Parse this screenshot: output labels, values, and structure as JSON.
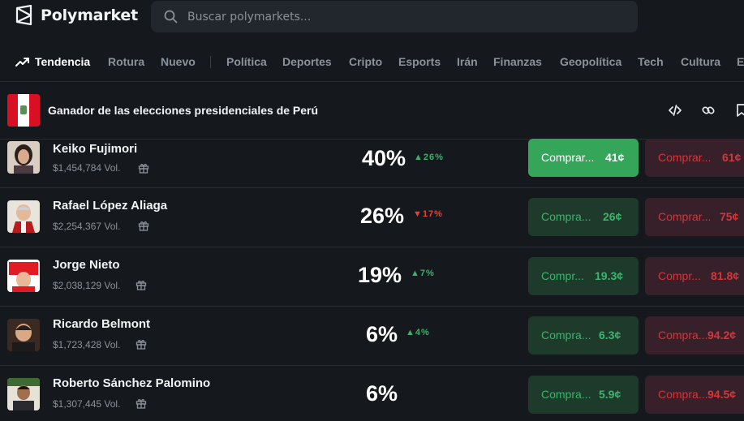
{
  "header": {
    "brand": "Polymarket",
    "search_placeholder": "Buscar polymarkets..."
  },
  "nav": {
    "items": [
      "Tendencia",
      "Rotura",
      "Nuevo",
      "Política",
      "Deportes",
      "Cripto",
      "Esports",
      "Irán",
      "Finanzas",
      "Geopolítica",
      "Tech",
      "Cultura",
      "E"
    ]
  },
  "market": {
    "title": "Ganador de las elecciones presidenciales de Perú",
    "outcomes": [
      {
        "name": "Keiko Fujimori",
        "volume": "$1,454,784 Vol.",
        "percent": "40%",
        "change": "26%",
        "direction": "up",
        "yes_label": "Comprar...",
        "yes_price": "41¢",
        "no_label": "Comprar...",
        "no_price": "61¢"
      },
      {
        "name": "Rafael López Aliaga",
        "volume": "$2,254,367 Vol.",
        "percent": "26%",
        "change": "17%",
        "direction": "down",
        "yes_label": "Compra...",
        "yes_price": "26¢",
        "no_label": "Comprar...",
        "no_price": "75¢"
      },
      {
        "name": "Jorge Nieto",
        "volume": "$2,038,129 Vol.",
        "percent": "19%",
        "change": "7%",
        "direction": "up",
        "yes_label": "Compr...",
        "yes_price": "19.3¢",
        "no_label": "Compr...",
        "no_price": "81.8¢"
      },
      {
        "name": "Ricardo Belmont",
        "volume": "$1,723,428 Vol.",
        "percent": "6%",
        "change": "4%",
        "direction": "up",
        "yes_label": "Compra...",
        "yes_price": "6.3¢",
        "no_label": "Compra...",
        "no_price": "94.2¢"
      },
      {
        "name": "Roberto Sánchez Palomino",
        "volume": "$1,307,445 Vol.",
        "percent": "6%",
        "change": "",
        "direction": "none",
        "yes_label": "Compra...",
        "yes_price": "5.9¢",
        "no_label": "Compra...",
        "no_price": "94.5¢"
      }
    ]
  },
  "icons": {
    "trend": "trending-up-icon",
    "search": "search-icon",
    "embed": "code-icon",
    "link": "link-icon",
    "bookmark": "bookmark-icon",
    "gift": "gift-icon"
  },
  "colors": {
    "background": "#15191d",
    "yes_primary": "#35a55a",
    "yes_muted": "#1e3a2b",
    "no_muted": "#37202a",
    "up": "#3fb068",
    "down": "#e0443b"
  }
}
